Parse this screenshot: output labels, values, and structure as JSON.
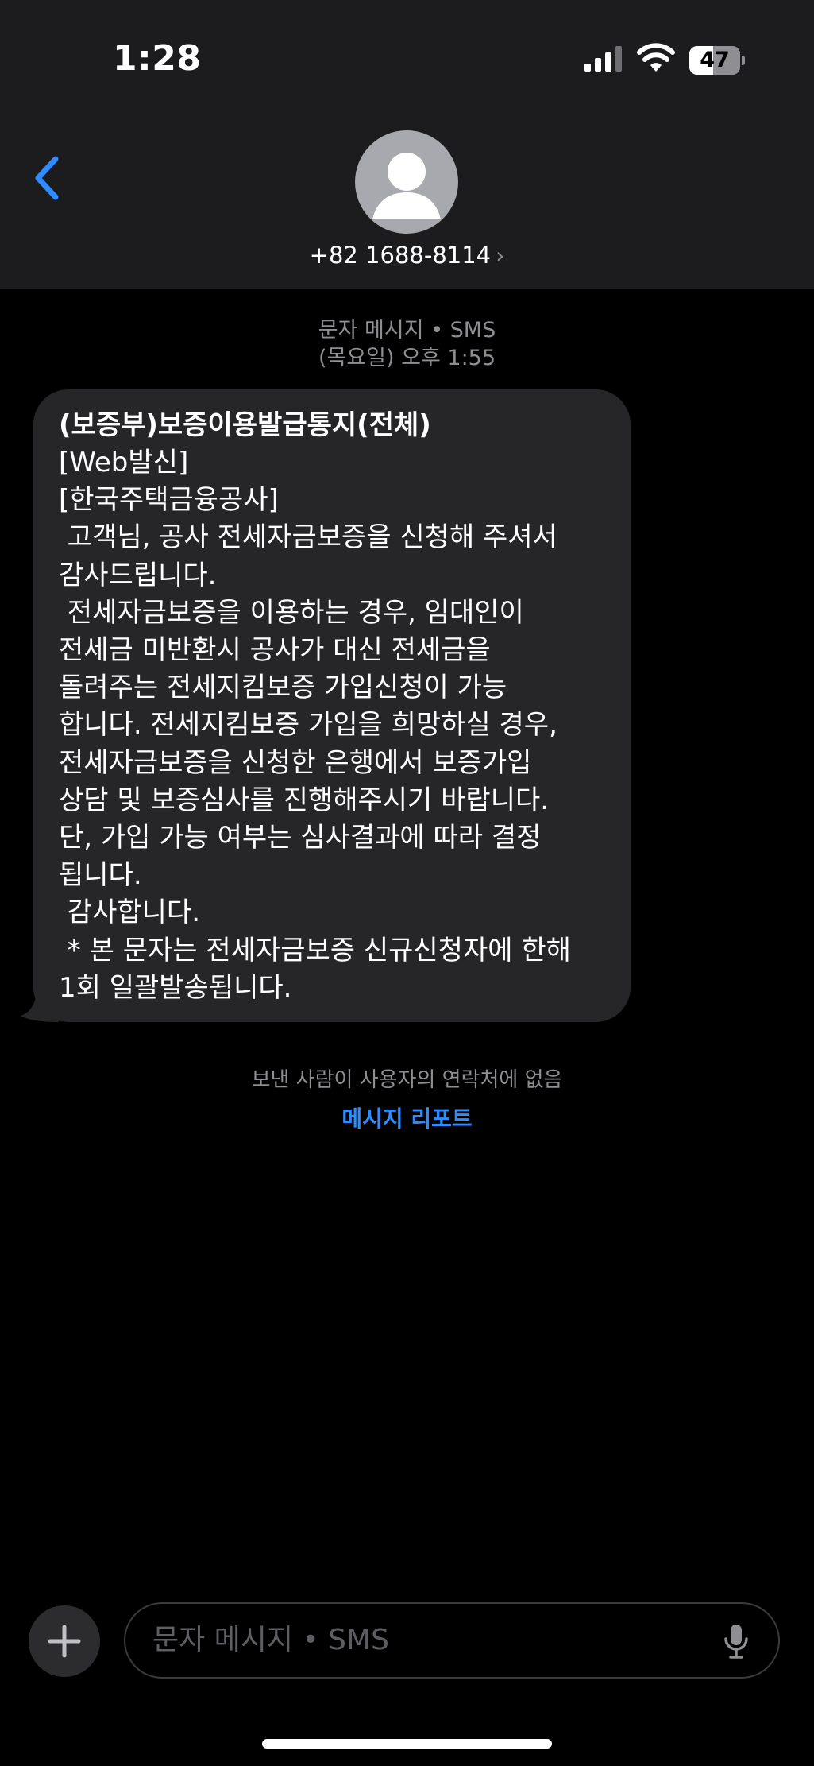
{
  "status_bar": {
    "time": "1:28",
    "battery": "47",
    "battery_level": 0.47
  },
  "nav": {
    "contact": "+82 1688-8114",
    "chevron": "›"
  },
  "message_meta": {
    "type": "문자 메시지 • SMS",
    "timestamp": "(목요일) 오후 1:55"
  },
  "message": {
    "title": "(보증부)보증이용발급통지(전체)",
    "body": "[Web발신]\n[한국주택금융공사]\n 고객님, 공사 전세자금보증을 신청해 주셔서\n감사드립니다.\n 전세자금보증을 이용하는 경우, 임대인이\n전세금 미반환시 공사가 대신 전세금을\n돌려주는 전세지킴보증 가입신청이 가능\n합니다. 전세지킴보증 가입을 희망하실 경우,\n전세자금보증을 신청한 은행에서 보증가입\n상담 및 보증심사를 진행해주시기 바랍니다.\n단, 가입 가능 여부는 심사결과에 따라 결정\n됩니다.\n 감사합니다.\n * 본 문자는 전세자금보증 신규신청자에 한해\n1회 일괄발송됩니다."
  },
  "notice": {
    "sender_note": "보낸 사람이 사용자의 연락처에 없음",
    "report_link": "메시지 리포트"
  },
  "input": {
    "placeholder": "문자 메시지 • SMS"
  },
  "icons": {
    "back": "chevron-left-icon",
    "avatar": "person-icon",
    "plus": "plus-icon",
    "mic": "microphone-icon",
    "signal": "cellular-signal-icon",
    "wifi": "wifi-icon",
    "battery": "battery-icon"
  },
  "colors": {
    "accent": "#2f8cff",
    "bubble": "#262628",
    "header": "#1c1c1e",
    "muted": "#8e8e93"
  }
}
